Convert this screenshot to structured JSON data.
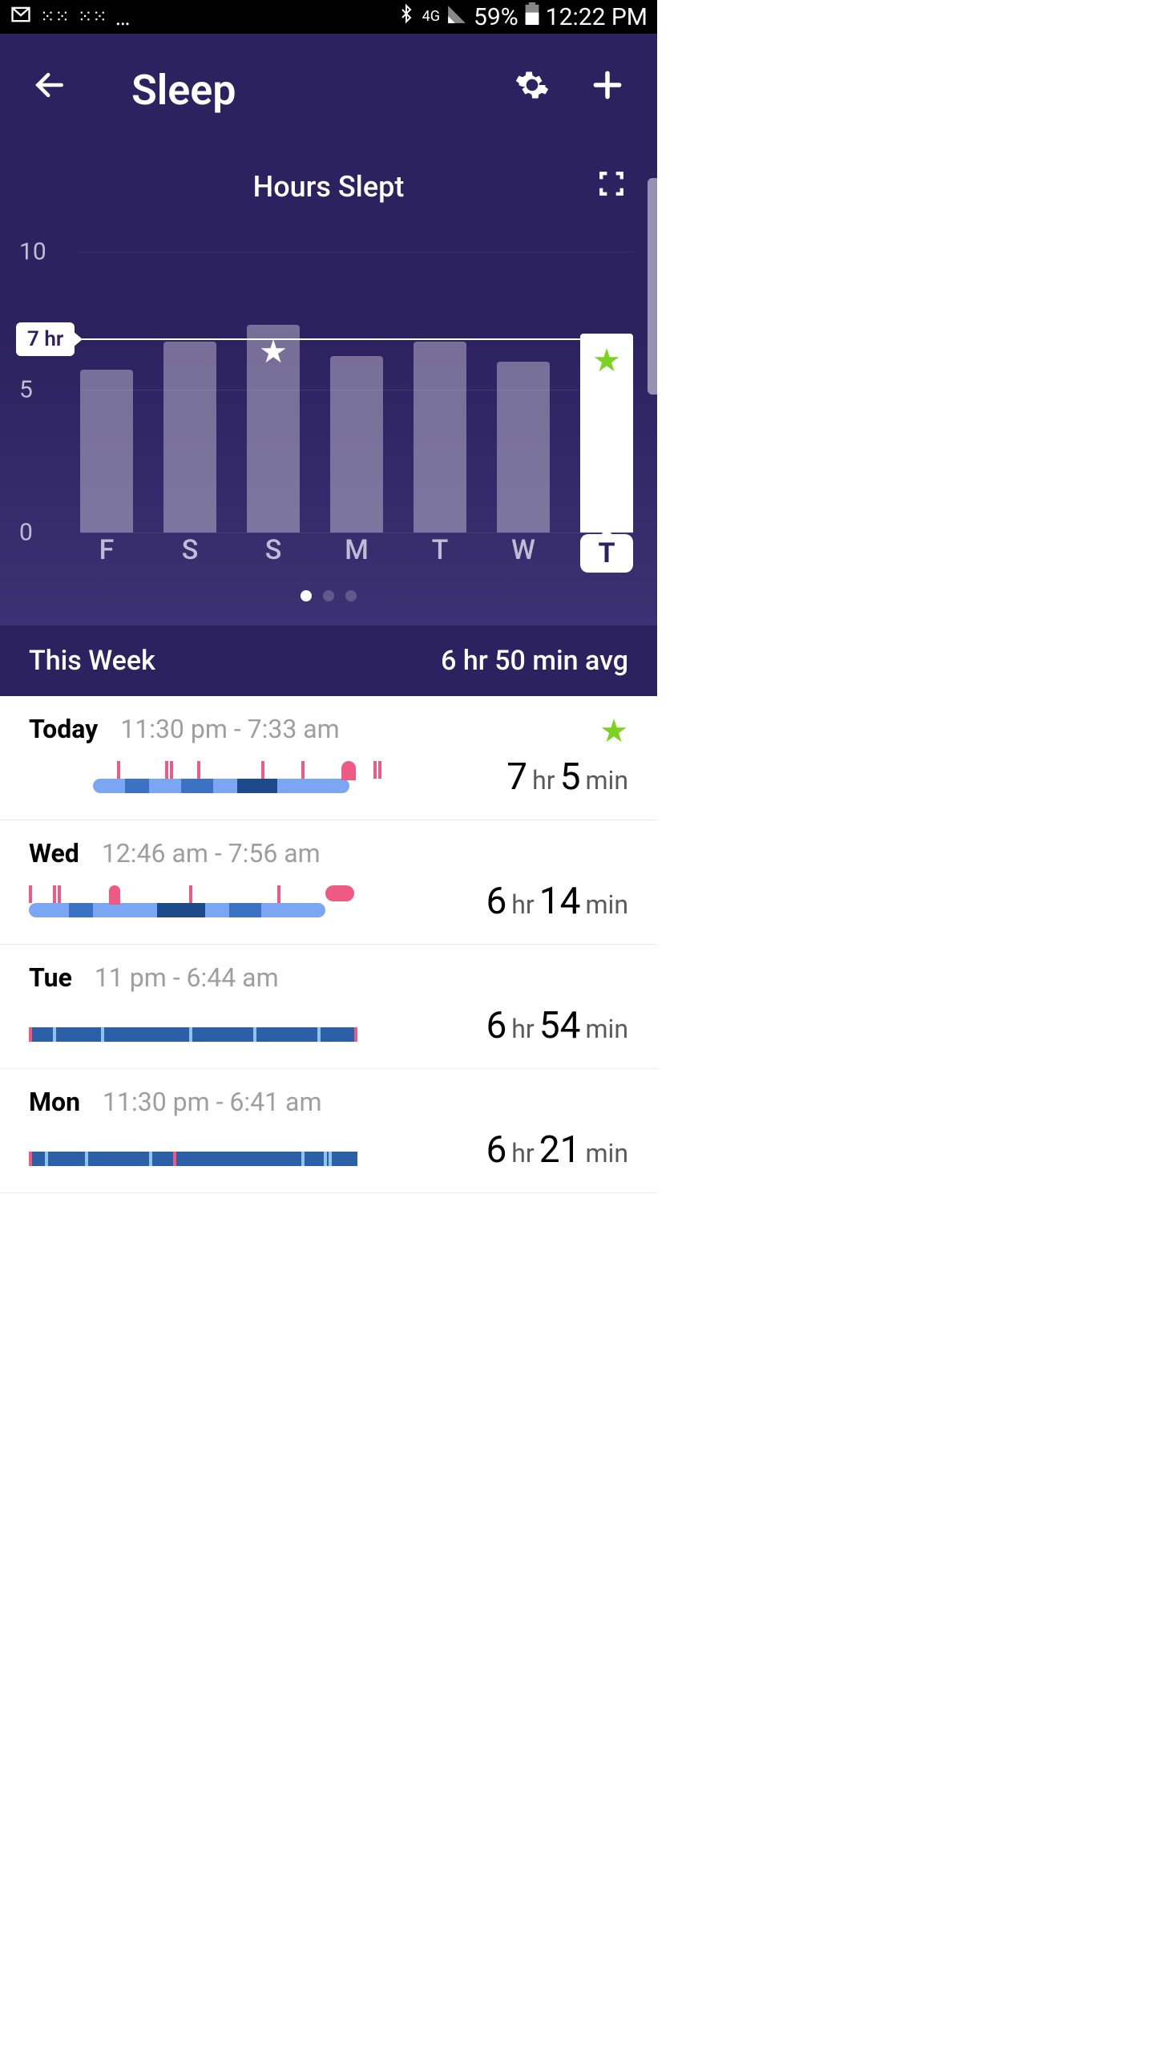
{
  "status_bar": {
    "battery_pct": "59%",
    "time": "12:22 PM",
    "network": "4G"
  },
  "header": {
    "title": "Sleep"
  },
  "chart": {
    "title": "Hours Slept",
    "goal_label": "7 hr",
    "y_ticks": [
      "10",
      "5",
      "0"
    ],
    "page_dots": 3,
    "active_dot": 0
  },
  "chart_data": {
    "type": "bar",
    "categories": [
      "F",
      "S",
      "S",
      "M",
      "T",
      "W",
      "T"
    ],
    "values": [
      5.8,
      6.8,
      7.4,
      6.3,
      6.8,
      6.1,
      7.1
    ],
    "goal": 7,
    "ylim": [
      0,
      10
    ],
    "title": "Hours Slept",
    "xlabel": "",
    "ylabel": "Hours",
    "selected_index": 6,
    "star_indices": [
      2,
      6
    ]
  },
  "summary": {
    "label": "This Week",
    "value": "6 hr 50 min avg"
  },
  "sleep_entries": [
    {
      "day": "Today",
      "times": "11:30 pm - 7:33 am",
      "duration_parts": [
        "7",
        "hr",
        "5",
        "min"
      ],
      "starred": true
    },
    {
      "day": "Wed",
      "times": "12:46 am - 7:56 am",
      "duration_parts": [
        "6",
        "hr",
        "14",
        "min"
      ],
      "starred": false
    },
    {
      "day": "Tue",
      "times": "11 pm - 6:44 am",
      "duration_parts": [
        "6",
        "hr",
        "54",
        "min"
      ],
      "starred": false
    },
    {
      "day": "Mon",
      "times": "11:30 pm - 6:41 am",
      "duration_parts": [
        "6",
        "hr",
        "21",
        "min"
      ],
      "starred": false
    }
  ]
}
